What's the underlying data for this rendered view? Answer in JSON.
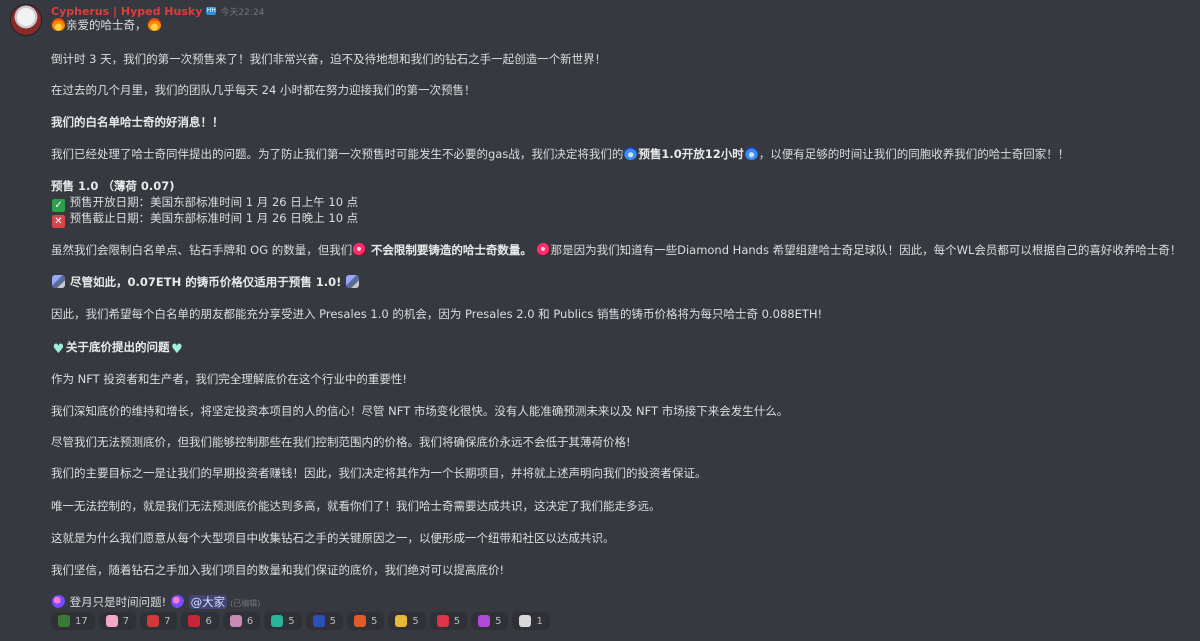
{
  "message": {
    "author": "Cypherus | Hyped Husky",
    "role_badge": "HH",
    "timestamp": "今天22:24",
    "greeting": "亲爱的哈士奇，",
    "lines": {
      "p1": "倒计时 3 天，我们的第一次预售来了！我们非常兴奋，迫不及待地想和我们的钻石之手一起创造一个新世界！",
      "p2": "在过去的几个月里，我们的团队几乎每天 24 小时都在努力迎接我们的第一次预售！",
      "p3": "我们的白名单哈士奇的好消息！！",
      "p4_a": "我们已经处理了哈士奇同伴提出的问题。为了防止我们第一次预售时可能发生不必要的gas战，我们决定将我们的",
      "p4_b": "预售1.0开放12小时",
      "p4_c": "，以便有足够的时间让我们的同胞收养我们的哈士奇回家！！",
      "p5_title": "预售 1.0 （薄荷 0.07)",
      "p5_open": "预售开放日期：美国东部标准时间 1 月 26 日上午 10 点",
      "p5_close": "预售截止日期：美国东部标准时间 1 月 26 日晚上 10 点",
      "p6_a": "虽然我们会限制白名单点、钻石手牌和 OG 的数量，但我们",
      "p6_b": "不会限制要铸造的哈士奇数量。",
      "p6_c": "那是因为我们知道有一些Diamond Hands 希望组建哈士奇足球队！因此，每个WL会员都可以根据自己的喜好收养哈士奇！",
      "p7": "尽管如此，0.07ETH 的铸币价格仅适用于预售 1.0!",
      "p8": "因此，我们希望每个白名单的朋友都能充分享受进入 Presales 1.0 的机会，因为 Presales 2.0 和 Publics 销售的铸币价格将为每只哈士奇 0.088ETH!",
      "p9": "关于底价提出的问题",
      "p10": "作为 NFT 投资者和生产者，我们完全理解底价在这个行业中的重要性!",
      "p11": "我们深知底价的维持和增长，将坚定投资本项目的人的信心！尽管 NFT 市场变化很快。没有人能准确预测未来以及 NFT 市场接下来会发生什么。",
      "p12": "尽管我们无法预测底价，但我们能够控制那些在我们控制范围内的价格。我们将确保底价永远不会低于其薄荷价格!",
      "p13": "我们的主要目标之一是让我们的早期投资者赚钱！因此，我们决定将其作为一个长期项目，并将就上述声明向我们的投资者保证。",
      "p14": "唯一无法控制的，就是我们无法预测底价能达到多高，就看你们了！我们哈士奇需要达成共识，这决定了我们能走多远。",
      "p15": "这就是为什么我们愿意从每个大型项目中收集钻石之手的关键原因之一，以便形成一个纽带和社区以达成共识。",
      "p16": "我们坚信，随着钻石之手加入我们项目的数量和我们保证的底价，我们绝对可以提高底价!",
      "p17": "登月只是时间问题!",
      "mention": "@大家",
      "edited": "(已编辑)"
    }
  },
  "reactions": [
    {
      "emoji": "tree-icon",
      "color": "#3b7a3b",
      "count": "17"
    },
    {
      "emoji": "pink-heart-icon",
      "color": "#f4a6c6",
      "count": "7"
    },
    {
      "emoji": "red-ring-icon",
      "color": "#d23a3a",
      "count": "7"
    },
    {
      "emoji": "red-circle-icon",
      "color": "#c8263a",
      "count": "6"
    },
    {
      "emoji": "ribbon-icon",
      "color": "#c98ab3",
      "count": "6"
    },
    {
      "emoji": "teal-badge-icon",
      "color": "#2bb39a",
      "count": "5"
    },
    {
      "emoji": "blue-sparkle-icon",
      "color": "#2c4fb8",
      "count": "5"
    },
    {
      "emoji": "fire-icon",
      "color": "#e05a2a",
      "count": "5"
    },
    {
      "emoji": "star-icon",
      "color": "#e5b93a",
      "count": "5"
    },
    {
      "emoji": "red-heart-icon",
      "color": "#e0334a",
      "count": "5"
    },
    {
      "emoji": "purple-check-icon",
      "color": "#b04ad6",
      "count": "5"
    },
    {
      "emoji": "face-icon",
      "color": "#d9d9d9",
      "count": "1"
    }
  ]
}
